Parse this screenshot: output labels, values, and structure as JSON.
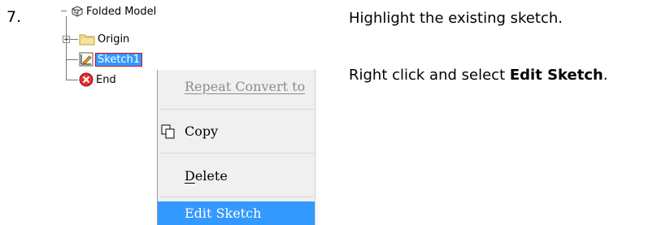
{
  "step_number": "7.",
  "tree": {
    "root_label": "Folded Model",
    "items": [
      {
        "label": "Origin",
        "icon": "folder-icon",
        "expander": "+"
      },
      {
        "label": "Sketch1",
        "icon": "sketch-icon",
        "selected": true
      },
      {
        "label": "End",
        "icon": "error-icon"
      }
    ]
  },
  "context_menu": {
    "items": [
      {
        "label": "Repeat Convert to",
        "state": "disabled"
      },
      {
        "label": "Copy",
        "icon": "copy-icon"
      },
      {
        "label": "Delete",
        "mnemonic": "D"
      },
      {
        "label": "Edit Sketch",
        "state": "highlighted"
      }
    ]
  },
  "instructions": {
    "line1": "Highlight the existing sketch.",
    "line2_prefix": "Right click and select ",
    "line2_bold": "Edit Sketch",
    "line2_suffix": "."
  },
  "colors": {
    "highlight": "#3399ff",
    "selection_border": "#c8102e",
    "menu_bg": "#f0f0f0",
    "disabled_text": "#8c8c8c"
  }
}
